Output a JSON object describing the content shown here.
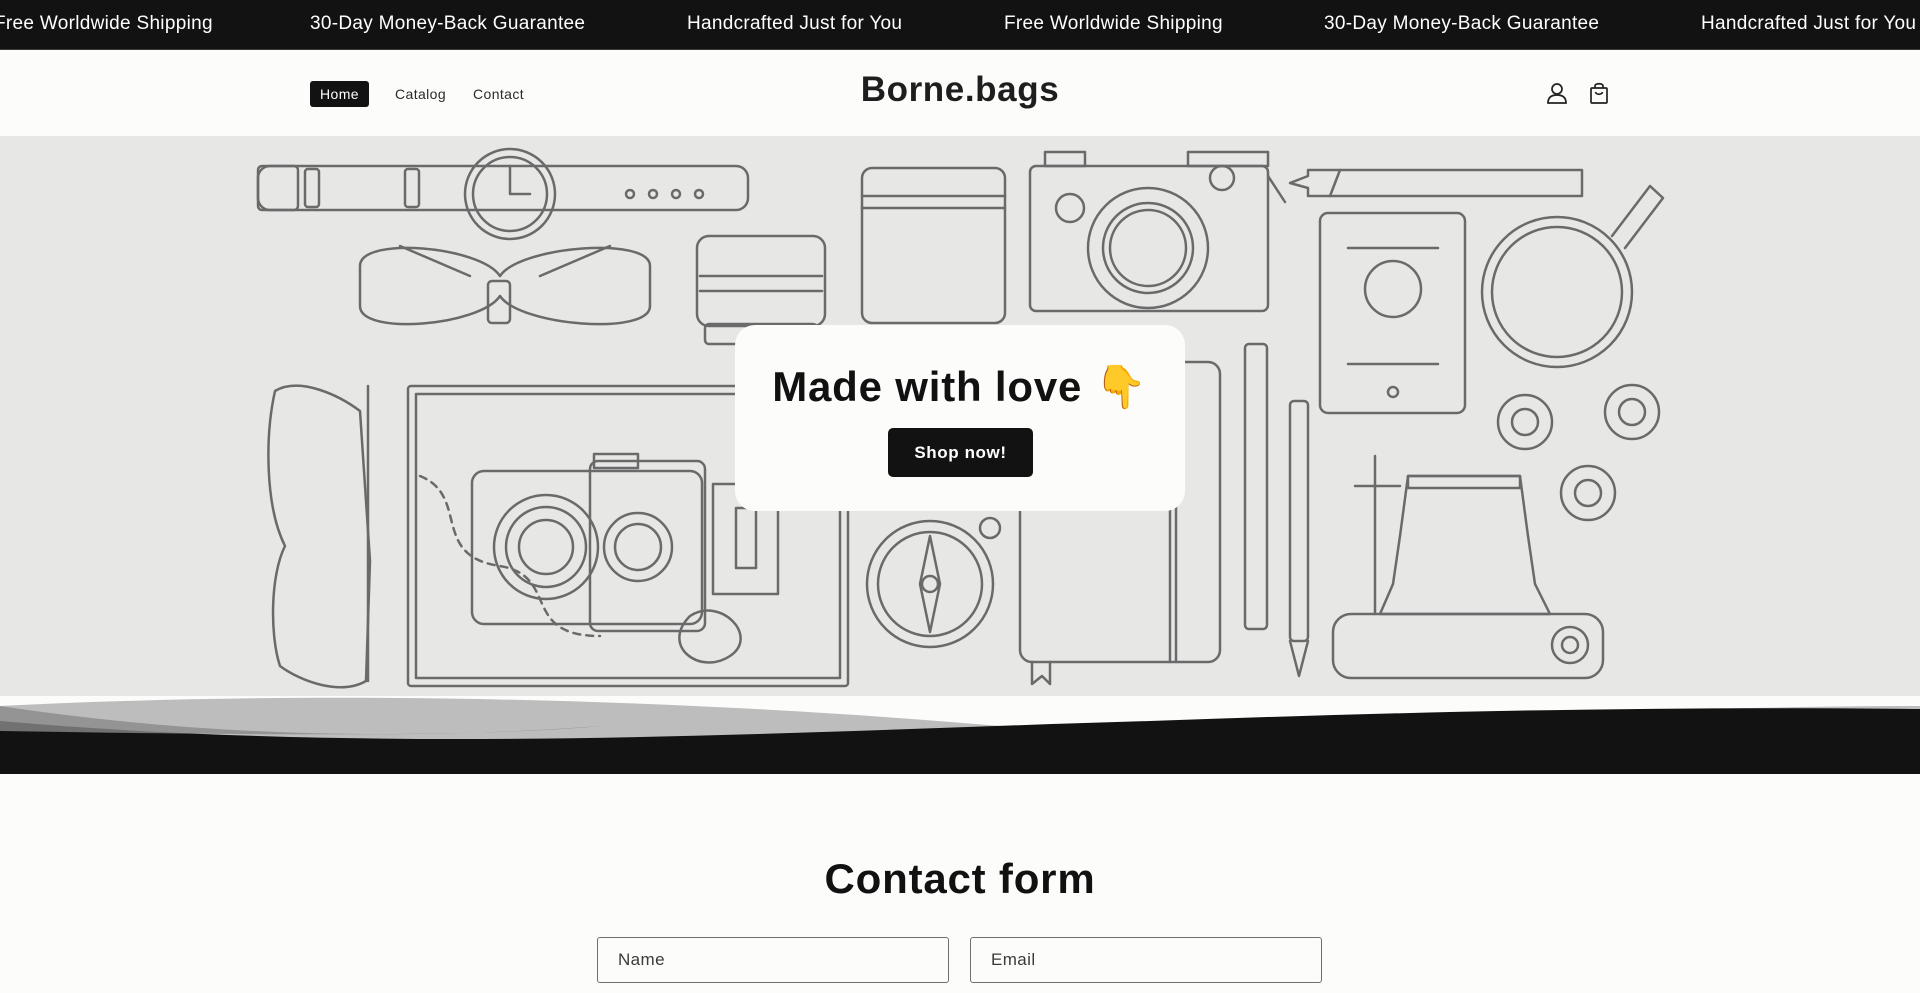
{
  "announcement": {
    "items": [
      "Free Worldwide Shipping",
      "30-Day Money-Back Guarantee",
      "Handcrafted Just for You",
      "Free Worldwide Shipping",
      "30-Day Money-Back Guarantee",
      "Handcrafted Just for You"
    ]
  },
  "header": {
    "nav": [
      "Home",
      "Catalog",
      "Contact"
    ],
    "active_nav": "Home",
    "logo": "Borne.bags",
    "icons": [
      "account-icon",
      "cart-icon"
    ]
  },
  "hero": {
    "title": "Made with love",
    "emoji": "👇",
    "button_label": "Shop now!"
  },
  "contact": {
    "title": "Contact form",
    "name_placeholder": "Name",
    "email_placeholder": "Email"
  },
  "colors": {
    "primary": "#121212",
    "background": "#fcfcfb",
    "hero_bg": "#e7e7e6",
    "line_art": "#6a6a6a"
  }
}
